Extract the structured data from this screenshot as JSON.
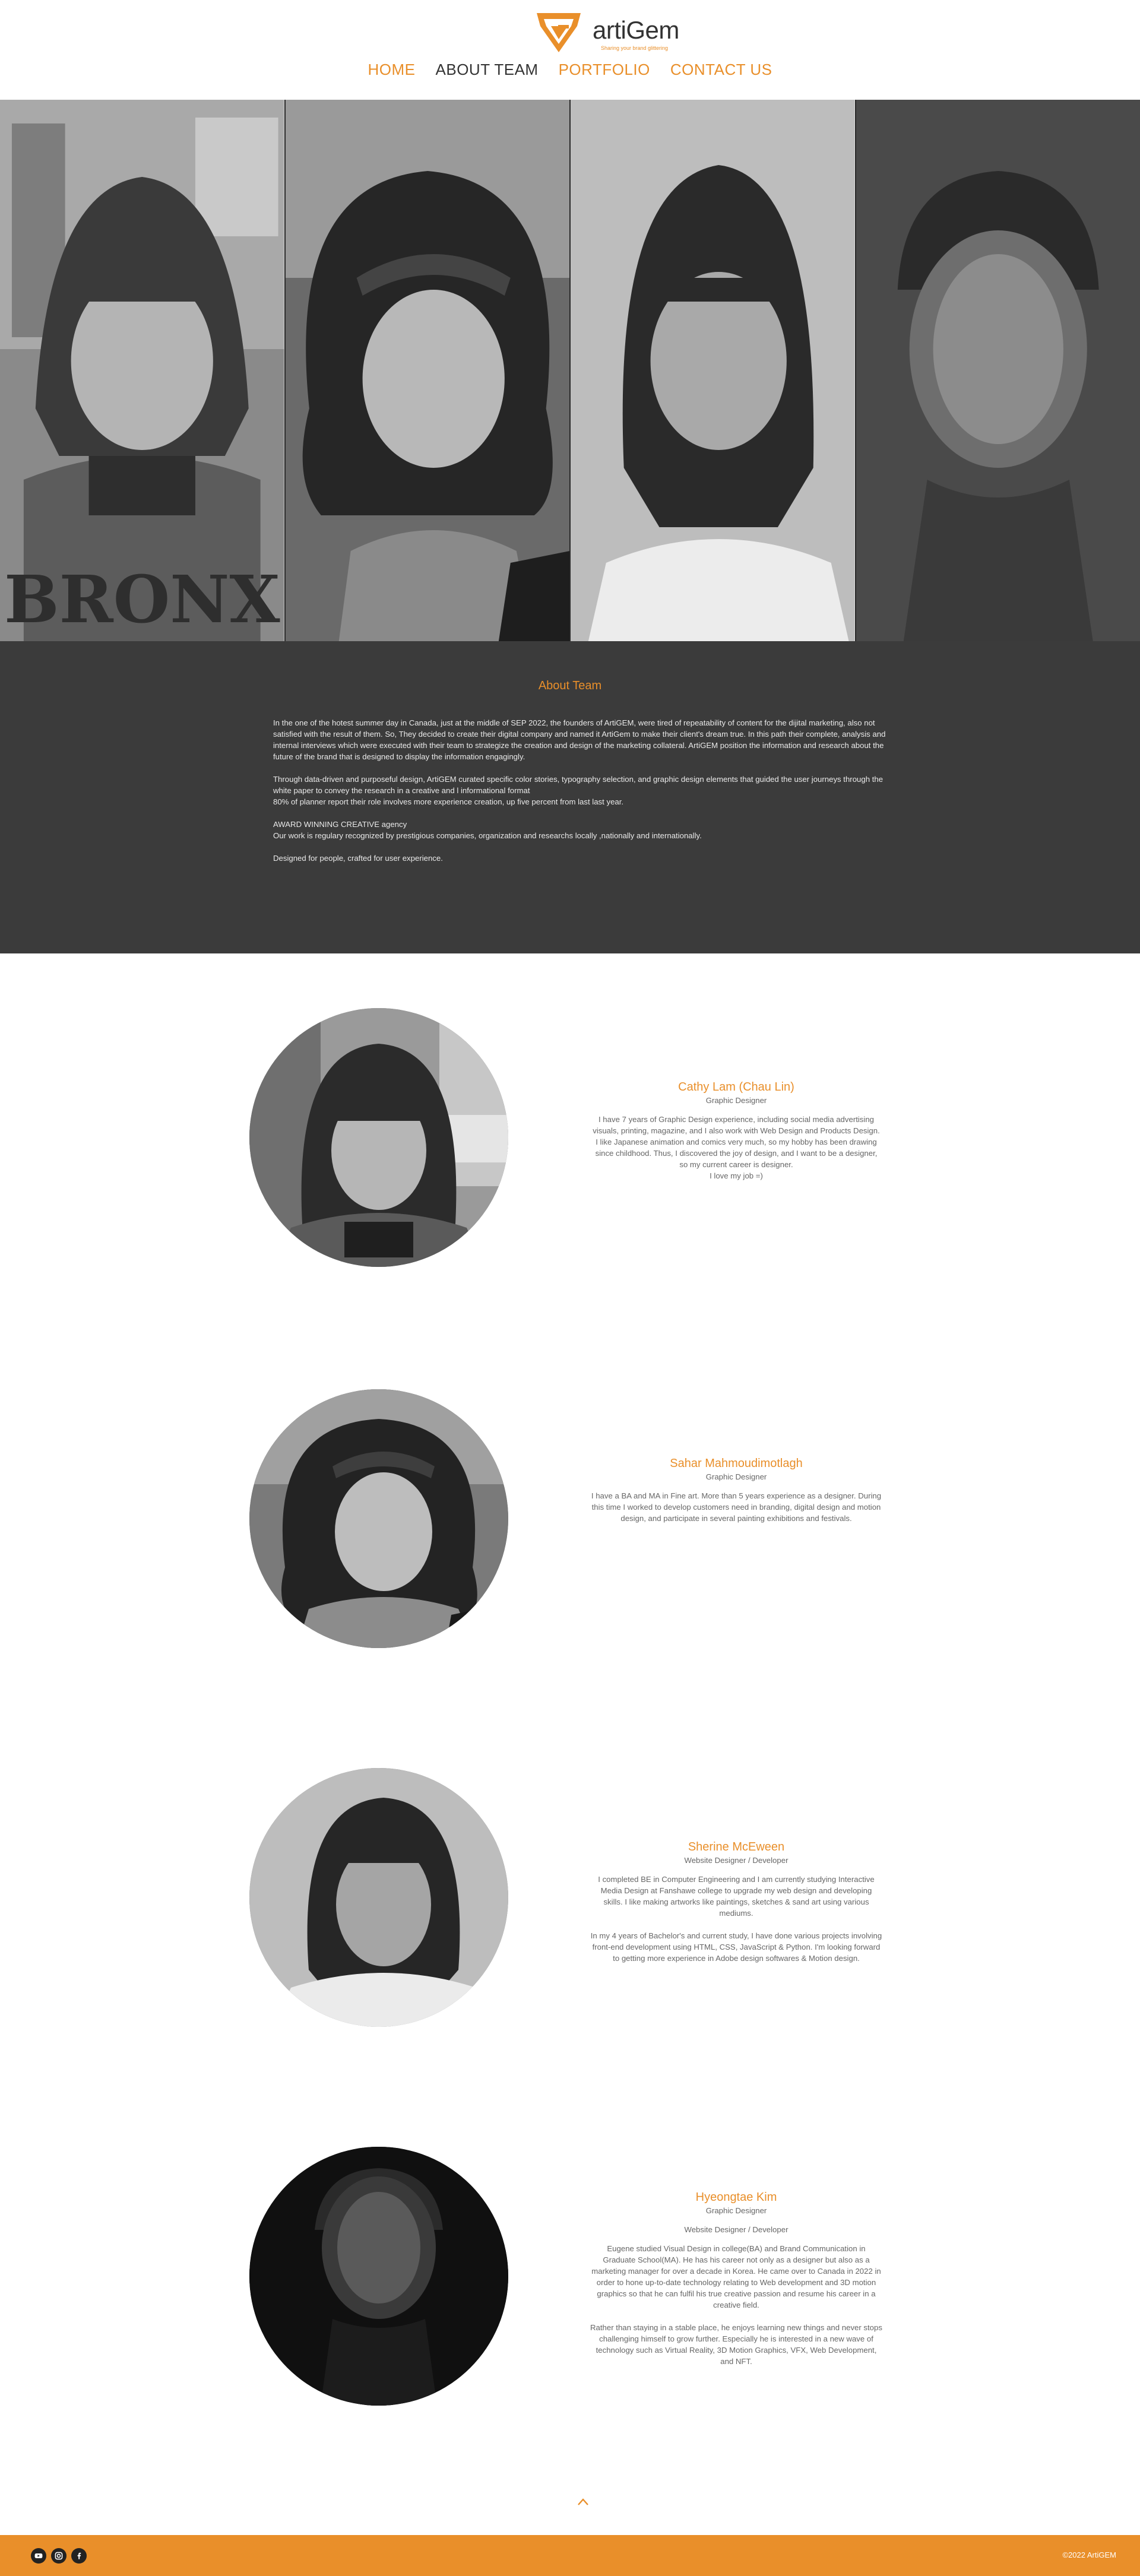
{
  "brand": {
    "name": "artiGem",
    "tagline": "Sharing your brand glittering",
    "accent_color": "#e98f2a",
    "dark_color": "#3b3b3b"
  },
  "nav": {
    "items": [
      {
        "label": "HOME"
      },
      {
        "label": "ABOUT TEAM"
      },
      {
        "label": "PORTFOLIO"
      },
      {
        "label": "CONTACT US"
      }
    ],
    "current": "ABOUT TEAM"
  },
  "about": {
    "title": "About Team",
    "paragraphs": [
      "In the one of the hotest summer day in Canada, just at the middle of SEP 2022, the founders of ArtiGEM, were tired of repeatability of content for the dijital marketing, also not satisfied with the result of them.  So, They decided  to  create their digital company and named it ArtiGem to make their client's dream true. In this path their complete, analysis and internal interviews which were executed with their team to strategize the creation and design of the marketing collateral. ArtiGEM position the information and research about the future of the brand that is designed to display the information engagingly.",
      "Through data-driven and purposeful design, ArtiGEM curated specific color stories, typography selection, and  graphic design elements that guided the user journeys through the white paper to convey the research in a creative and l informational format\n80% of planner report their role involves more experience creation, up five percent from last last year.",
      "AWARD WINNING CREATIVE agency\nOur work is regulary recognized by prestigious companies, organization and researchs locally ,nationally and internationally.",
      "Designed for people, crafted for user experience."
    ]
  },
  "members": [
    {
      "name": "Cathy Lam (Chau Lin)",
      "role": "Graphic Designer",
      "paragraphs": [
        "I have 7 years of Graphic Design experience, including social media advertising visuals, printing, magazine, and I also work with Web Design and Products Design.\nI like Japanese animation and comics very much, so my hobby has been drawing since childhood. Thus, I discovered the joy of design, and I want to be a designer, so my current career is designer.\nI love my job =)"
      ]
    },
    {
      "name": "Sahar Mahmoudimotlagh",
      "role": "Graphic Designer",
      "paragraphs": [
        "I have a BA and MA in Fine art. More than 5 years experience as a designer. During this time I worked to develop customers need in branding, digital design and motion design, and participate in several painting exhibitions and festivals."
      ]
    },
    {
      "name": "Sherine McEween",
      "role": "Website Designer / Developer",
      "paragraphs": [
        "I completed BE in Computer Engineering and I am currently studying Interactive Media Design at Fanshawe college to upgrade my web design and developing skills. I like making artworks like paintings, sketches & sand art using various mediums.",
        "In my 4 years of Bachelor's and current study, I have done various projects involving front-end development using HTML, CSS, JavaScript & Python. I'm looking forward to getting more experience in Adobe design softwares & Motion design."
      ]
    },
    {
      "name": "Hyeongtae Kim",
      "role": "Graphic Designer",
      "role2": "Website Designer / Developer",
      "paragraphs": [
        "Eugene studied Visual Design in college(BA) and Brand Communication in Graduate School(MA). He has his career not only as a designer but also as a marketing manager for over a decade in Korea. He came over to Canada in 2022 in order to hone up-to-date technology relating to Web development and 3D motion graphics so that he can fulfil his true creative passion and resume his career in a creative field.",
        "Rather than staying in a stable place, he enjoys learning new things and never stops challenging himself to grow further. Especially he is interested in a new wave of technology such as Virtual Reality, 3D Motion Graphics, VFX, Web Development, and NFT."
      ]
    }
  ],
  "footer": {
    "copyright": "©2022 ArtiGEM",
    "social": [
      "youtube-icon",
      "instagram-icon",
      "facebook-icon"
    ]
  }
}
